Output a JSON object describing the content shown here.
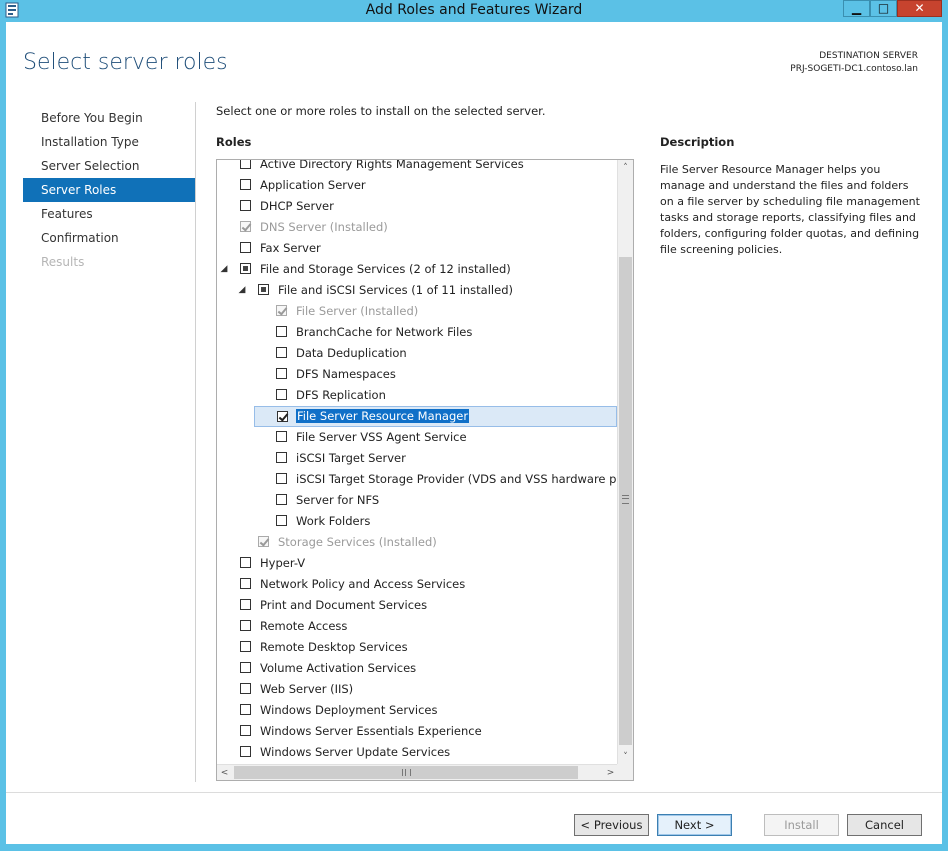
{
  "window": {
    "title": "Add Roles and Features Wizard",
    "controls": {
      "minimize": "▁",
      "maximize": "□",
      "close": "✕"
    }
  },
  "header": {
    "page_title": "Select server roles",
    "destination_label": "DESTINATION SERVER",
    "destination_server": "PRJ-SOGETI-DC1.contoso.lan"
  },
  "nav": [
    {
      "label": "Before You Begin",
      "state": "normal"
    },
    {
      "label": "Installation Type",
      "state": "normal"
    },
    {
      "label": "Server Selection",
      "state": "normal"
    },
    {
      "label": "Server Roles",
      "state": "active"
    },
    {
      "label": "Features",
      "state": "normal"
    },
    {
      "label": "Confirmation",
      "state": "normal"
    },
    {
      "label": "Results",
      "state": "disabled"
    }
  ],
  "main": {
    "instruction": "Select one or more roles to install on the selected server.",
    "roles_label": "Roles",
    "description_label": "Description",
    "description_text": "File Server Resource Manager helps you manage and understand the files and folders on a file server by scheduling file management tasks and storage reports, classifying files and folders, configuring folder quotas, and defining file screening policies."
  },
  "roles": [
    {
      "label": "Active Directory Rights Management Services",
      "level": 0,
      "checkbox": "unchecked",
      "expander": ""
    },
    {
      "label": "Application Server",
      "level": 0,
      "checkbox": "unchecked",
      "expander": ""
    },
    {
      "label": "DHCP Server",
      "level": 0,
      "checkbox": "unchecked",
      "expander": ""
    },
    {
      "label": "DNS Server (Installed)",
      "level": 0,
      "checkbox": "checked-disabled",
      "expander": ""
    },
    {
      "label": "Fax Server",
      "level": 0,
      "checkbox": "unchecked",
      "expander": ""
    },
    {
      "label": "File and Storage Services (2 of 12 installed)",
      "level": 0,
      "checkbox": "partial",
      "expander": "expanded"
    },
    {
      "label": "File and iSCSI Services (1 of 11 installed)",
      "level": 1,
      "checkbox": "partial",
      "expander": "expanded"
    },
    {
      "label": "File Server (Installed)",
      "level": 2,
      "checkbox": "checked-disabled",
      "expander": ""
    },
    {
      "label": "BranchCache for Network Files",
      "level": 2,
      "checkbox": "unchecked",
      "expander": ""
    },
    {
      "label": "Data Deduplication",
      "level": 2,
      "checkbox": "unchecked",
      "expander": ""
    },
    {
      "label": "DFS Namespaces",
      "level": 2,
      "checkbox": "unchecked",
      "expander": ""
    },
    {
      "label": "DFS Replication",
      "level": 2,
      "checkbox": "unchecked",
      "expander": ""
    },
    {
      "label": "File Server Resource Manager",
      "level": 2,
      "checkbox": "checked",
      "expander": "",
      "selected": true
    },
    {
      "label": "File Server VSS Agent Service",
      "level": 2,
      "checkbox": "unchecked",
      "expander": ""
    },
    {
      "label": "iSCSI Target Server",
      "level": 2,
      "checkbox": "unchecked",
      "expander": ""
    },
    {
      "label": "iSCSI Target Storage Provider (VDS and VSS hardware provid",
      "level": 2,
      "checkbox": "unchecked",
      "expander": ""
    },
    {
      "label": "Server for NFS",
      "level": 2,
      "checkbox": "unchecked",
      "expander": ""
    },
    {
      "label": "Work Folders",
      "level": 2,
      "checkbox": "unchecked",
      "expander": ""
    },
    {
      "label": "Storage Services (Installed)",
      "level": 1,
      "checkbox": "checked-disabled",
      "expander": ""
    },
    {
      "label": "Hyper-V",
      "level": 0,
      "checkbox": "unchecked",
      "expander": ""
    },
    {
      "label": "Network Policy and Access Services",
      "level": 0,
      "checkbox": "unchecked",
      "expander": ""
    },
    {
      "label": "Print and Document Services",
      "level": 0,
      "checkbox": "unchecked",
      "expander": ""
    },
    {
      "label": "Remote Access",
      "level": 0,
      "checkbox": "unchecked",
      "expander": ""
    },
    {
      "label": "Remote Desktop Services",
      "level": 0,
      "checkbox": "unchecked",
      "expander": ""
    },
    {
      "label": "Volume Activation Services",
      "level": 0,
      "checkbox": "unchecked",
      "expander": ""
    },
    {
      "label": "Web Server (IIS)",
      "level": 0,
      "checkbox": "unchecked",
      "expander": ""
    },
    {
      "label": "Windows Deployment Services",
      "level": 0,
      "checkbox": "unchecked",
      "expander": ""
    },
    {
      "label": "Windows Server Essentials Experience",
      "level": 0,
      "checkbox": "unchecked",
      "expander": ""
    },
    {
      "label": "Windows Server Update Services",
      "level": 0,
      "checkbox": "unchecked",
      "expander": ""
    }
  ],
  "scrollbar": {
    "up": "˄",
    "down": "˅",
    "left": "<",
    "right": ">"
  },
  "buttons": {
    "previous": "< Previous",
    "next": "Next >",
    "install": "Install",
    "cancel": "Cancel"
  }
}
